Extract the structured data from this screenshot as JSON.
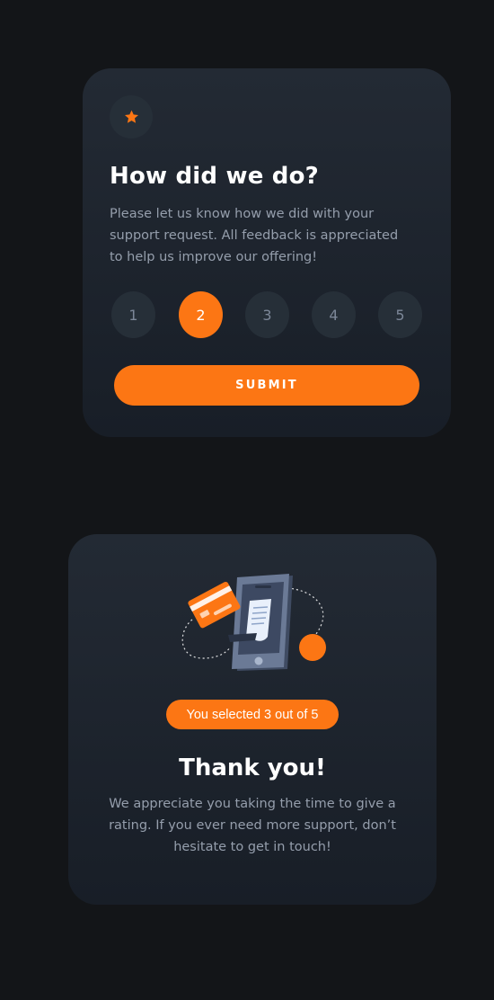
{
  "rating_card": {
    "icon": "star-icon",
    "title": "How did we do?",
    "description": "Please let us know how we did with your support request. All feedback is appreciated to help us improve our offering!",
    "ratings": [
      "1",
      "2",
      "3",
      "4",
      "5"
    ],
    "selected_rating": 2,
    "submit_label": "SUBMIT"
  },
  "thanks_card": {
    "illustration": "payment-phone-illustration",
    "result_text": "You selected 3 out of 5",
    "title": "Thank you!",
    "description": "We appreciate you taking the time to give a rating. If you ever need more support, don’t hesitate to get in touch!"
  },
  "colors": {
    "background": "#131518",
    "card_top": "#232A34",
    "card_bottom": "#181E27",
    "accent": "#FC7614",
    "muted_circle": "#262F38",
    "muted_text": "#959EAC",
    "light_grey": "#7C8798",
    "white": "#FFFFFF"
  }
}
